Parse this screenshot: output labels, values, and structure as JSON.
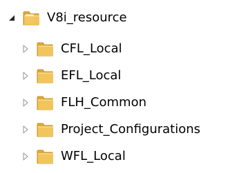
{
  "tree": {
    "root": {
      "label": "V8i_resource",
      "expanded": true,
      "icon": "folder-icon"
    },
    "children": [
      {
        "label": "CFL_Local",
        "expanded": false,
        "icon": "folder-icon"
      },
      {
        "label": "EFL_Local",
        "expanded": false,
        "icon": "folder-icon"
      },
      {
        "label": "FLH_Common",
        "expanded": false,
        "icon": "folder-icon"
      },
      {
        "label": "Project_Configurations",
        "expanded": false,
        "icon": "folder-icon"
      },
      {
        "label": "WFL_Local",
        "expanded": false,
        "icon": "folder-icon"
      }
    ]
  },
  "colors": {
    "folder_body": "#f2c55c",
    "folder_dark": "#d9a93a",
    "folder_paper": "#ffffff",
    "folder_edge": "#c89224",
    "expander_expanded": "#262626",
    "expander_collapsed": "#a6a6a6",
    "text": "#000000"
  }
}
